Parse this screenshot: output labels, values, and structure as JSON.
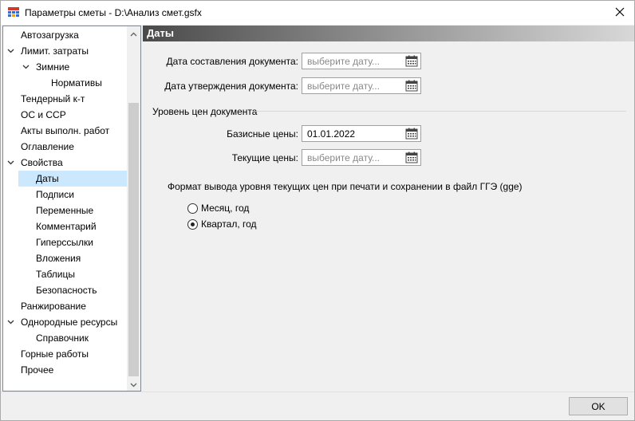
{
  "window": {
    "title": "Параметры сметы - D:\\Анализ смет.gsfx",
    "app_icon": "table-grid-icon",
    "close_icon": "close-icon"
  },
  "tree": {
    "selected": "Даты",
    "items": [
      {
        "label": "Автозагрузка",
        "level": 0,
        "toggle": ""
      },
      {
        "label": "Лимит. затраты",
        "level": 0,
        "toggle": "chevron-down"
      },
      {
        "label": "Зимние",
        "level": 1,
        "toggle": "chevron-down"
      },
      {
        "label": "Нормативы",
        "level": 2,
        "toggle": ""
      },
      {
        "label": "Тендерный к-т",
        "level": 0,
        "toggle": ""
      },
      {
        "label": "ОС и ССР",
        "level": 0,
        "toggle": ""
      },
      {
        "label": "Акты выполн. работ",
        "level": 0,
        "toggle": ""
      },
      {
        "label": "Оглавление",
        "level": 0,
        "toggle": ""
      },
      {
        "label": "Свойства",
        "level": 0,
        "toggle": "chevron-down"
      },
      {
        "label": "Даты",
        "level": 1,
        "toggle": ""
      },
      {
        "label": "Подписи",
        "level": 1,
        "toggle": ""
      },
      {
        "label": "Переменные",
        "level": 1,
        "toggle": ""
      },
      {
        "label": "Комментарий",
        "level": 1,
        "toggle": ""
      },
      {
        "label": "Гиперссылки",
        "level": 1,
        "toggle": ""
      },
      {
        "label": "Вложения",
        "level": 1,
        "toggle": ""
      },
      {
        "label": "Таблицы",
        "level": 1,
        "toggle": ""
      },
      {
        "label": "Безопасность",
        "level": 1,
        "toggle": ""
      },
      {
        "label": "Ранжирование",
        "level": 0,
        "toggle": ""
      },
      {
        "label": "Однородные ресурсы",
        "level": 0,
        "toggle": "chevron-down"
      },
      {
        "label": "Справочник",
        "level": 1,
        "toggle": ""
      },
      {
        "label": "Горные работы",
        "level": 0,
        "toggle": ""
      },
      {
        "label": "Прочее",
        "level": 0,
        "toggle": ""
      }
    ]
  },
  "content": {
    "section_title": "Даты",
    "doc_date": {
      "label": "Дата составления документа:",
      "value": "",
      "placeholder": "выберите дату..."
    },
    "approve_date": {
      "label": "Дата утверждения документа:",
      "value": "",
      "placeholder": "выберите дату..."
    },
    "price_group_title": "Уровень цен документа",
    "base_prices": {
      "label": "Базисные цены:",
      "value": "01.01.2022",
      "placeholder": "выберите дату..."
    },
    "current_prices": {
      "label": "Текущие цены:",
      "value": "",
      "placeholder": "выберите дату..."
    },
    "format_label": "Формат вывода уровня текущих цен при печати и сохранении в файл ГГЭ (gge)",
    "format_options": [
      {
        "label": "Месяц, год",
        "checked": false
      },
      {
        "label": "Квартал, год",
        "checked": true
      }
    ]
  },
  "footer": {
    "ok_label": "OK"
  },
  "colors": {
    "selection": "#cce8ff",
    "header_gradient_start": "#4a4a4a"
  }
}
